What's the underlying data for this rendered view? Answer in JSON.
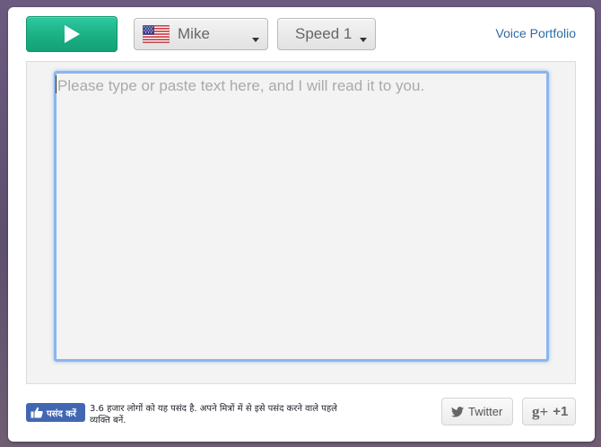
{
  "toolbar": {
    "play_icon": "play-icon",
    "voice": {
      "flag_icon": "us-flag-icon",
      "label": "Mike",
      "caret_icon": "caret-down-icon"
    },
    "speed": {
      "label": "Speed 1",
      "caret_icon": "caret-down-icon"
    },
    "portfolio_link": "Voice Portfolio"
  },
  "editor": {
    "placeholder": "Please type or paste text here, and I will read it to you.",
    "value": ""
  },
  "footer": {
    "like_button": "पसंद करें",
    "like_text": "3.6 हजार लोगों को यह पसंद है. अपने मित्रों में से इसे पसंद करने वाले पहले व्यक्ति बनें.",
    "twitter_label": "Twitter",
    "gplus_icon": "g+",
    "gplus_label": "+1"
  },
  "colors": {
    "play_green": "#1bb084",
    "link_blue": "#2d6aa6",
    "focus_blue": "#8ab6ee",
    "facebook_blue": "#4267b2",
    "background": "#6b5b80"
  }
}
